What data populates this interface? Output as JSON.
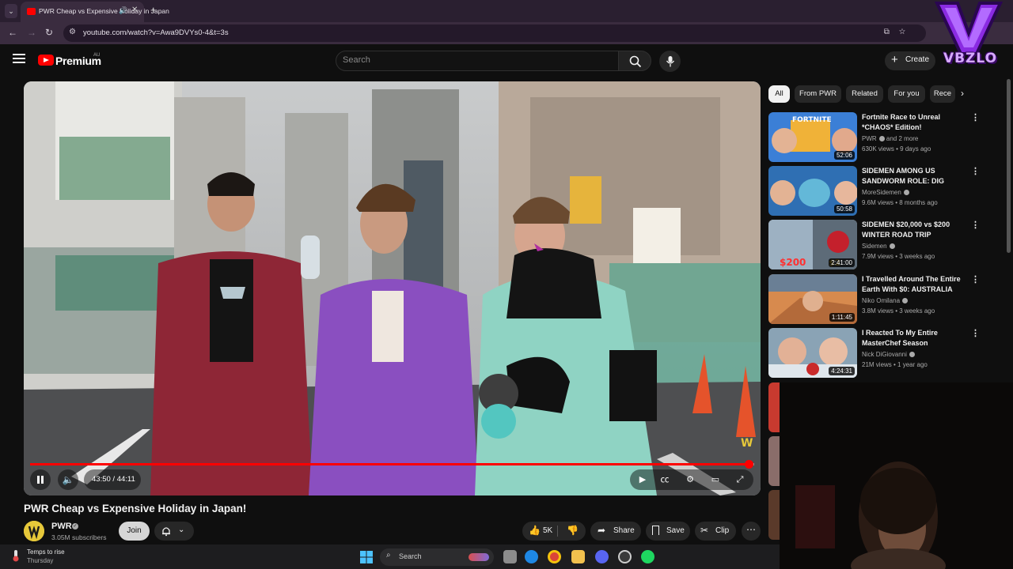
{
  "browser": {
    "tab_title": "PWR Cheap vs Expensive Holiday in Japan",
    "url": "youtube.com/watch?v=Awa9DVYs0-4&t=3s"
  },
  "overlay_logo": {
    "text": "VBZLO"
  },
  "header": {
    "brand": "Premium",
    "region": "AU",
    "search_placeholder": "Search",
    "create_label": "Create"
  },
  "player": {
    "time": "43:50 / 44:11",
    "progress_fraction": 0.992
  },
  "video": {
    "title": "PWR Cheap vs Expensive Holiday in Japan!",
    "channel": "PWR",
    "subscribers": "3.05M subscribers",
    "join_label": "Join",
    "likes": "5K",
    "share_label": "Share",
    "save_label": "Save",
    "clip_label": "Clip"
  },
  "chips": [
    "All",
    "From PWR",
    "Related",
    "For you",
    "Rece"
  ],
  "recommendations": [
    {
      "title": "Fortnite Race to Unreal *CHAOS* Edition!",
      "channel": "PWR",
      "channel_suffix": "and 2 more",
      "meta": "630K views • 9 days ago",
      "duration": "52:06"
    },
    {
      "title": "SIDEMEN AMONG US SANDWORM ROLE: DIG UNDE...",
      "channel": "MoreSidemen",
      "channel_suffix": "",
      "meta": "9.6M views • 8 months ago",
      "duration": "50:58"
    },
    {
      "title": "SIDEMEN $20,000 vs $200 WINTER ROAD TRIP",
      "channel": "Sidemen",
      "channel_suffix": "",
      "meta": "7.9M views • 3 weeks ago",
      "duration": "2:41:00"
    },
    {
      "title": "I Travelled Around The Entire Earth With $0: AUSTRALIA",
      "channel": "Niko Omilana",
      "channel_suffix": "",
      "meta": "3.8M views • 3 weeks ago",
      "duration": "1:11:45"
    },
    {
      "title": "I Reacted To My Entire MasterChef Season",
      "channel": "Nick DiGiovanni",
      "channel_suffix": "",
      "meta": "21M views • 1 year ago",
      "duration": "4:24:31"
    }
  ],
  "taskbar": {
    "weather_title": "Temps to rise",
    "weather_sub": "Thursday",
    "search_label": "Search"
  },
  "colors": {
    "accent": "#ff0000",
    "chrome": "#3a2c3f",
    "background": "#0f0f0f"
  }
}
